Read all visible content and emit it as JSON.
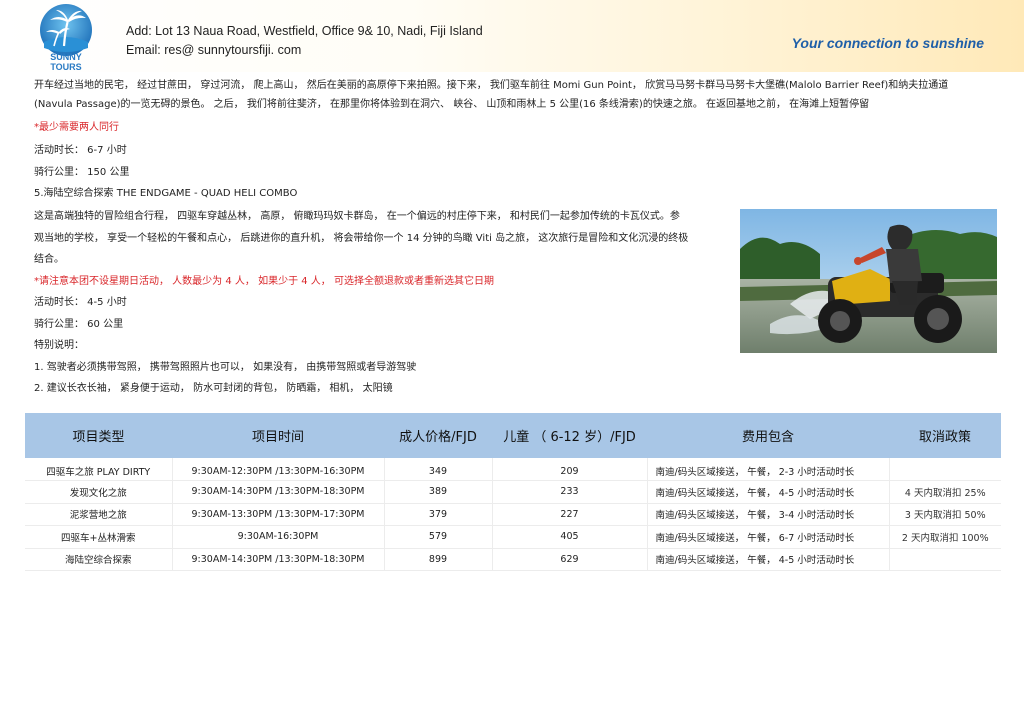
{
  "header": {
    "logo_text": "SUNNY TOURS",
    "address": "Add:  Lot 13  Naua  Road,  Westfield,  Office 9& 10,  Nadi,  Fiji Island",
    "email": "Email:   res@ sunnytoursfiji. com",
    "tagline": "Your  connection  to  sunshine"
  },
  "intro": {
    "line1": "开车经过当地的民宅，   经过甘蔗田，   穿过河流，   爬上高山，   然后在美丽的高原停下来拍照。接下来，   我们驱车前往 Momi Gun Point，   欣赏马马努卡群马马努卡大堡礁(Malolo Barrier Reef)和纳夫拉通道",
    "line2": "(Navula Passage)的一览无碍的景色。   之后，   我们将前往斐济，   在那里你将体验到在洞穴、   峡谷、   山顶和雨林上 5 公里(16 条线滑索)的快速之旅。   在返回基地之前，   在海滩上短暂停留",
    "note": "*最少需要两人同行",
    "duration": "活动时长：   6-7 小时",
    "distance": "骑行公里：    150 公里"
  },
  "section5": {
    "title": "5.海陆空综合探索   THE  ENDGAME  -  QUAD  HELI  COMBO",
    "desc1": "这是高端独特的冒险组合行程，   四驱车穿越丛林，   高原，   俯瞰玛玛奴卡群岛，   在一个偏远的村庄停下来，   和村民们一起参加传统的卡瓦仪式。参",
    "desc2": "观当地的学校，   享受一个轻松的午餐和点心，   后跳进你的直升机，   将会带给你一个  14 分钟的鸟瞰  Viti 岛之旅，   这次旅行是冒险和文化沉浸的终极",
    "desc3": "结合。",
    "note": "*请注意本团不设星期日活动，    人数最少为 4 人，    如果少于 4 人，    可选择全额退款或者重新选其它日期",
    "duration": "活动时长：   4-5 小时",
    "distance": "骑行公里：   60 公里",
    "special_title": "特别说明：",
    "item1": "1.   驾驶者必须携带驾照，   携带驾照照片也可以，   如果没有，   由携带驾照或者导游驾驶",
    "item2": "2.   建议长衣长袖，   紧身便于运动，   防水可封闭的背包，   防晒霜，   相机，   太阳镜"
  },
  "table": {
    "headers": [
      "项目类型",
      "项目时间",
      "成人价格/FJD",
      "儿童  （ 6-12 岁）/FJD",
      "费用包含",
      "取消政策"
    ],
    "rows": [
      {
        "type": "四驱车之旅   PLAY DIRTY",
        "time": "9:30AM-12:30PM /13:30PM-16:30PM",
        "adult": "349",
        "child": "209",
        "includes": "南迪/码头区域接送，   午餐，   2-3 小时活动时长",
        "cancel": ""
      },
      {
        "type": "发现文化之旅",
        "time": "9:30AM-14:30PM /13:30PM-18:30PM",
        "adult": "389",
        "child": "233",
        "includes": "南迪/码头区域接送，   午餐，   4-5 小时活动时长",
        "cancel": "4 天内取消扣 25%"
      },
      {
        "type": "泥浆营地之旅",
        "time": "9:30AM-13:30PM /13:30PM-17:30PM",
        "adult": "379",
        "child": "227",
        "includes": "南迪/码头区域接送，   午餐，   3-4 小时活动时长",
        "cancel": "3 天内取消扣 50%"
      },
      {
        "type": "四驱车+丛林滑索",
        "time": "9:30AM-16:30PM",
        "adult": "579",
        "child": "405",
        "includes": "南迪/码头区域接送，   午餐，   6-7 小时活动时长",
        "cancel": "2 天内取消扣 100%"
      },
      {
        "type": "海陆空综合探索",
        "time": "9:30AM-14:30PM /13:30PM-18:30PM",
        "adult": "899",
        "child": "629",
        "includes": "南迪/码头区域接送，   午餐，   4-5 小时活动时长",
        "cancel": ""
      }
    ]
  },
  "colors": {
    "accent_blue": "#1f5fa8",
    "table_header": "#a8c6e6",
    "note_red": "#d9262a"
  }
}
